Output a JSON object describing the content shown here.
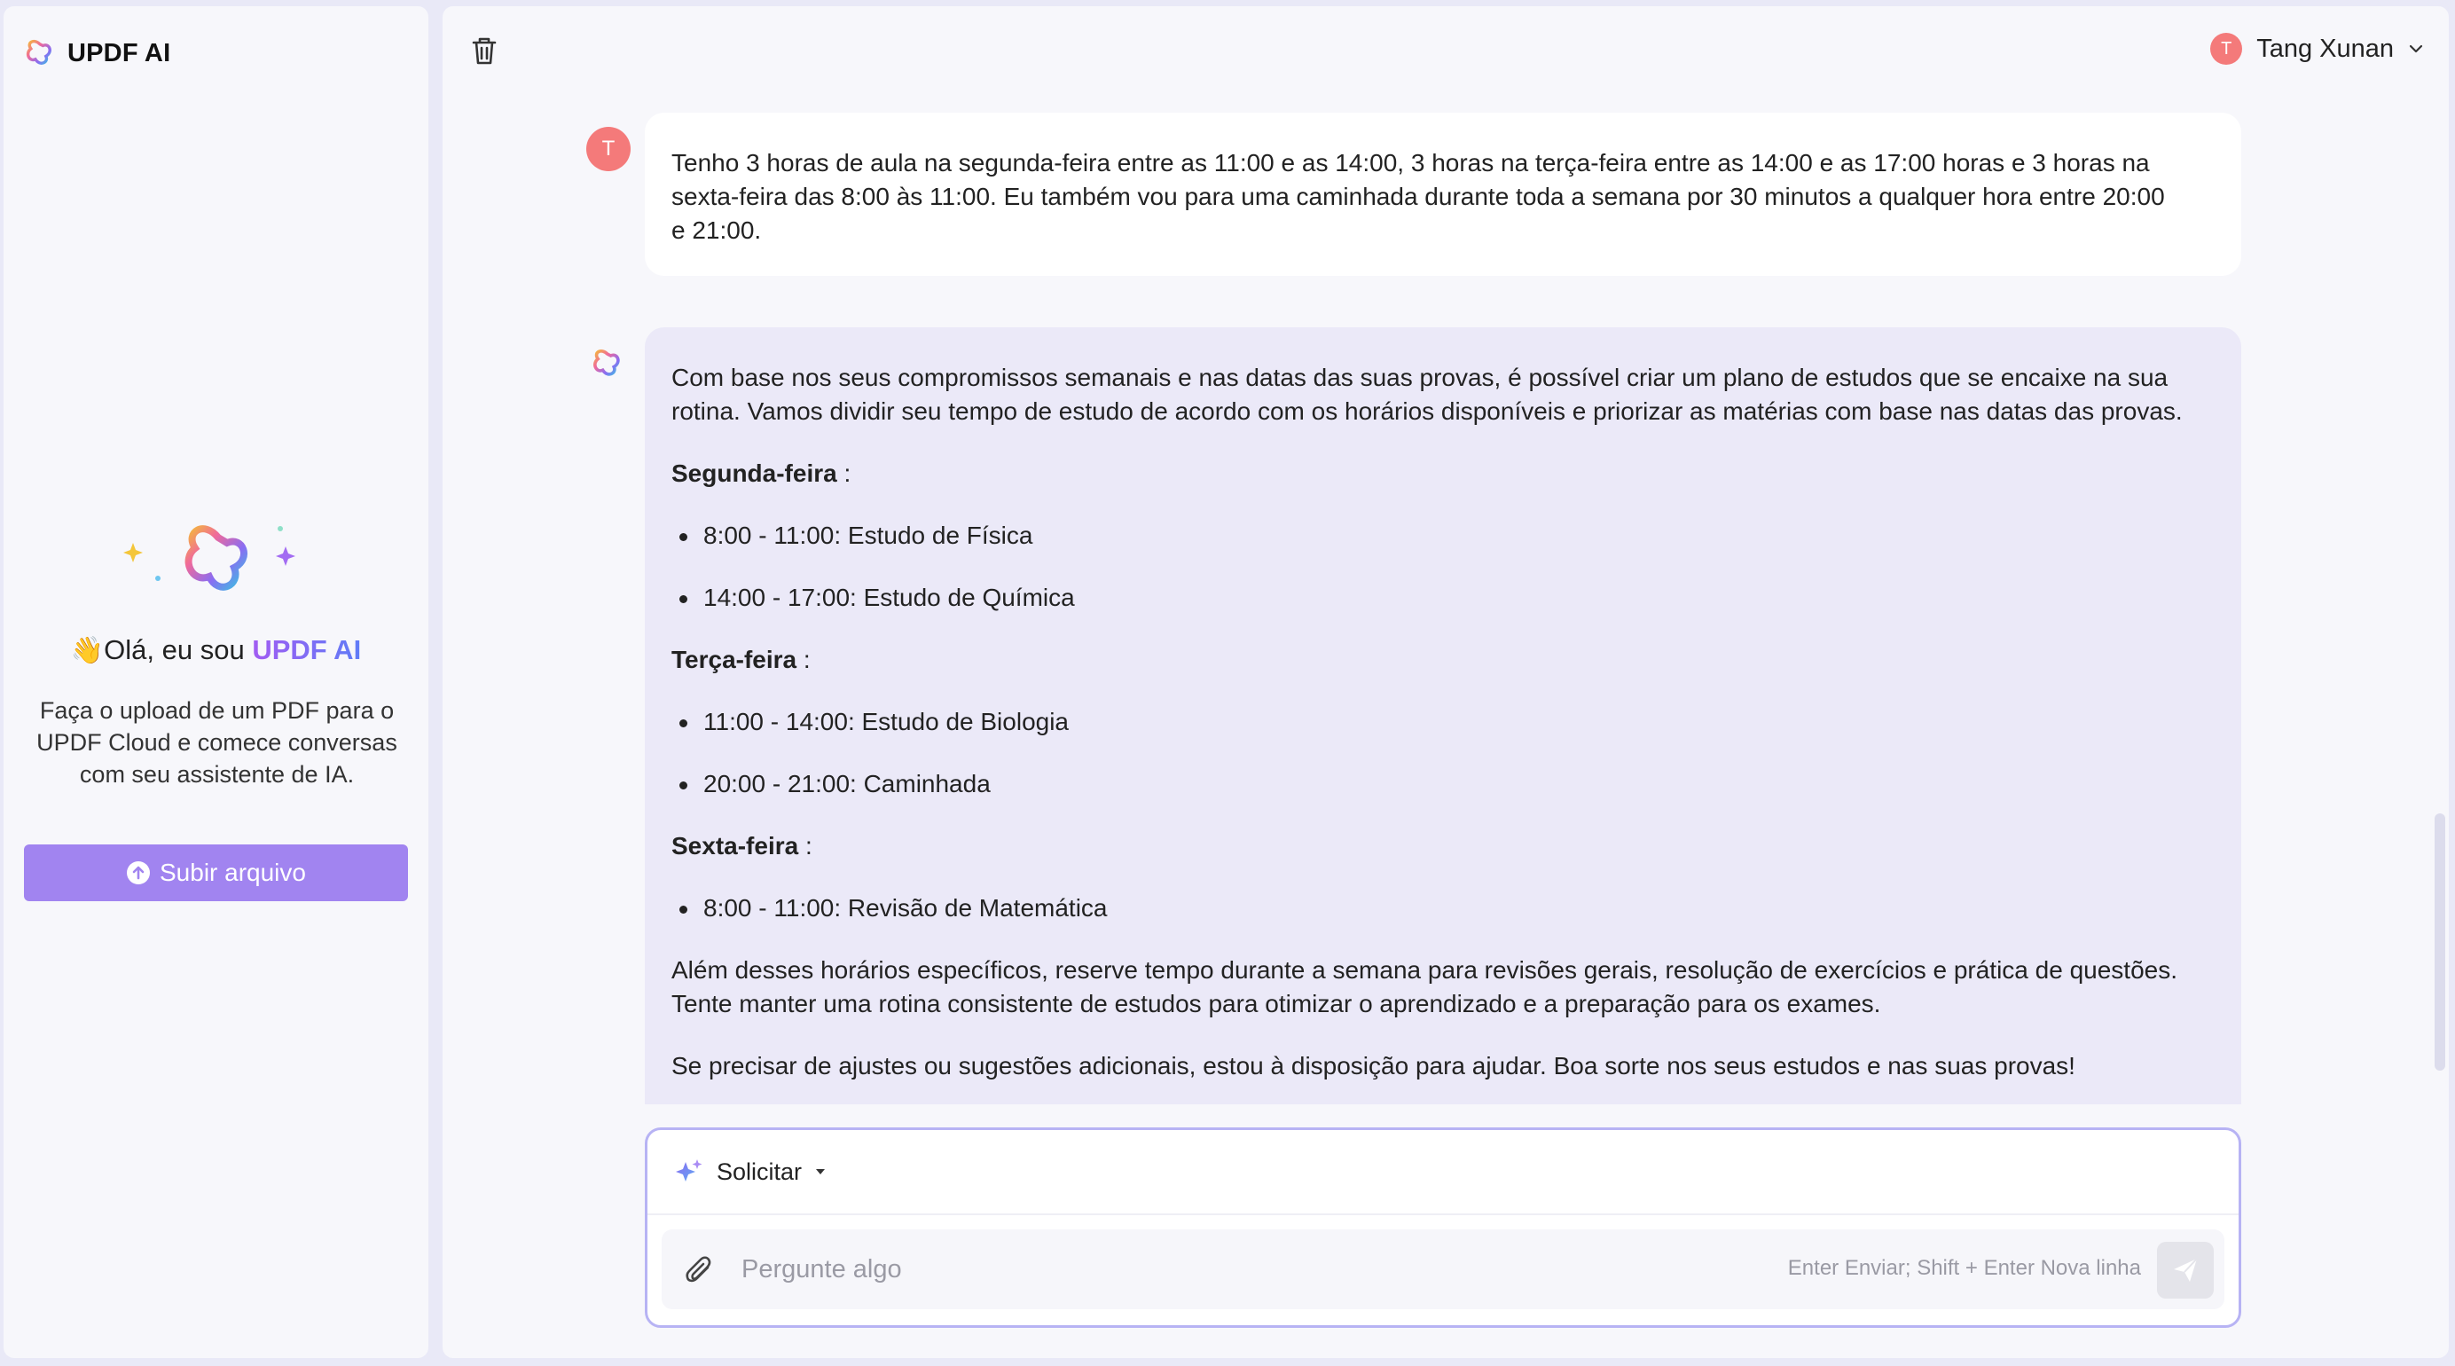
{
  "app": {
    "brand": "UPDF AI"
  },
  "sidebar": {
    "welcome_prefix": "Olá, eu sou ",
    "welcome_brand": "UPDF AI",
    "description": "Faça o upload de um PDF para o UPDF Cloud e comece conversas com seu assistente de IA.",
    "upload_label": "Subir arquivo"
  },
  "header": {
    "user_initial": "T",
    "user_name": "Tang Xunan"
  },
  "chat": {
    "user_avatar_initial": "T",
    "user_message_lines": [
      "Tenho 3 horas de aula na segunda-feira entre as 11:00 e as 14:00, 3 horas na terça-feira entre as 14:00 e as 17:00 horas e 3 horas na",
      "sexta-feira das 8:00 às 11:00. Eu também vou para uma caminhada durante toda a semana por 30 minutos a qualquer hora entre 20:00",
      "e 21:00."
    ],
    "ai_intro_lines": [
      "Com base nos seus compromissos semanais e nas datas das suas provas, é possível criar um plano de estudos que se encaixe na sua",
      "rotina. Vamos dividir seu tempo de estudo de acordo com os horários disponíveis e priorizar as matérias com base nas datas das provas."
    ],
    "days": [
      {
        "name": "Segunda-feira",
        "suffix": " :",
        "items": [
          "8:00 - 11:00: Estudo de Física",
          "14:00 - 17:00: Estudo de Química"
        ]
      },
      {
        "name": "Terça-feira",
        "suffix": " :",
        "items": [
          "11:00 - 14:00: Estudo de Biologia",
          "20:00 - 21:00: Caminhada"
        ]
      },
      {
        "name": "Sexta-feira",
        "suffix": " :",
        "items": [
          "8:00 - 11:00: Revisão de Matemática"
        ]
      }
    ],
    "ai_outro_lines": [
      "Além desses horários específicos, reserve tempo durante a semana para revisões gerais, resolução de exercícios e prática de questões.",
      "Tente manter uma rotina consistente de estudos para otimizar o aprendizado e a preparação para os exames."
    ],
    "ai_closing": "Se precisar de ajustes ou sugestões adicionais, estou à disposição para ajudar. Boa sorte nos seus estudos e nas suas provas!"
  },
  "composer": {
    "prompt_label": "Solicitar",
    "placeholder": "Pergunte algo",
    "hint": "Enter Enviar; Shift + Enter Nova linha"
  },
  "colors": {
    "accent": "#a184f0",
    "avatar": "#f47a7a",
    "ai_bubble": "#ebe9f8",
    "composer_border": "#b7b3f4"
  },
  "icons": [
    "updf-logo-icon",
    "trash-icon",
    "chevron-down-icon",
    "sparkle-icon",
    "paperclip-icon",
    "send-icon",
    "upload-icon",
    "waving-hand-icon"
  ]
}
